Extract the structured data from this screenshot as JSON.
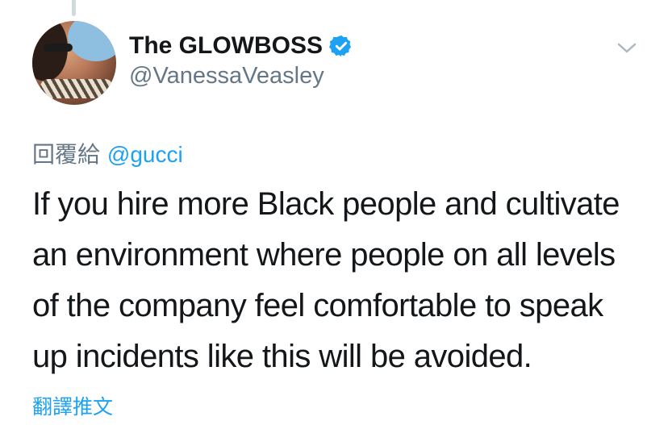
{
  "tweet": {
    "display_name": "The GLOWBOSS",
    "handle": "@VanessaVeasley",
    "verified": true,
    "reply_prefix": "回覆給",
    "reply_to": "@gucci",
    "text": "If you hire more Black people and cultivate\nan environment where people on all levels\nof the company feel comfortable to speak\nup incidents like this will be avoided.",
    "translate_label": "翻譯推文"
  },
  "colors": {
    "accent": "#1da1f2",
    "text": "#14171a",
    "secondary": "#657786"
  },
  "icons": {
    "verified": "verified-badge-icon",
    "menu": "chevron-down-icon"
  }
}
